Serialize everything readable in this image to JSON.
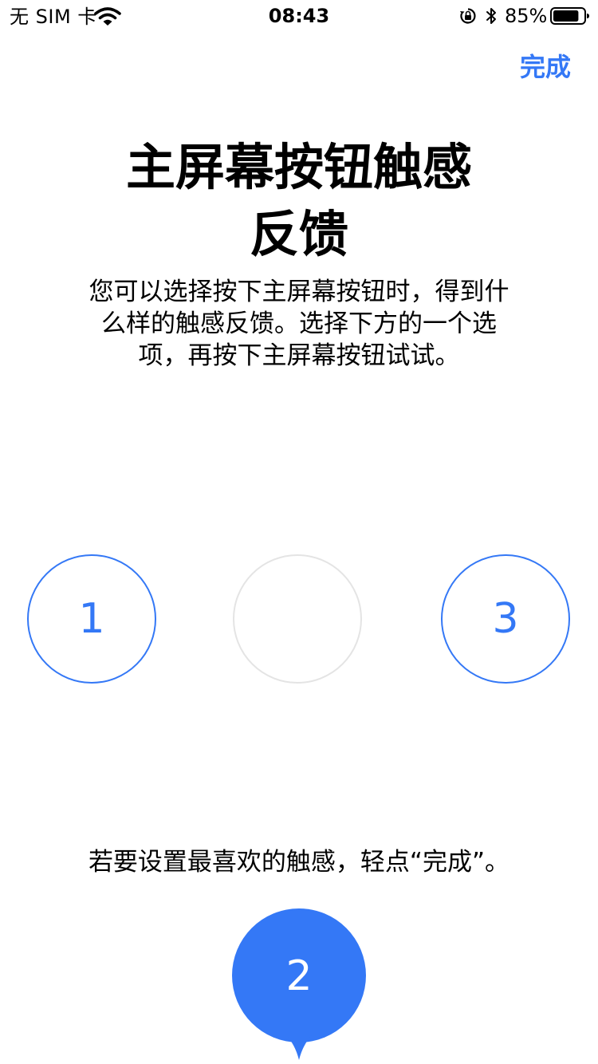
{
  "status_bar": {
    "carrier": "无 SIM 卡",
    "time": "08:43",
    "battery_percent": "85%",
    "icons": [
      "wifi-icon",
      "rotation-lock-icon",
      "bluetooth-icon",
      "battery-icon"
    ],
    "battery_level": 0.85
  },
  "nav": {
    "done_label": "完成"
  },
  "title": {
    "line1": "主屏幕按钮触感",
    "line2": "反馈"
  },
  "description": {
    "line1": "您可以选择按下主屏幕按钮时，得到什",
    "line2": "么样的触感反馈。选择下方的一个选",
    "line3": "项，再按下主屏幕按钮试试。"
  },
  "options": [
    {
      "label": "1",
      "state": "unselected"
    },
    {
      "label": "",
      "state": "empty-slot"
    },
    {
      "label": "3",
      "state": "unselected"
    }
  ],
  "hint": "若要设置最喜欢的触感，轻点“完成”。",
  "selected_option": {
    "label": "2"
  },
  "colors": {
    "accent": "#3478f6",
    "empty_slot_border": "#e4e4e4",
    "text": "#000000",
    "background": "#ffffff"
  }
}
